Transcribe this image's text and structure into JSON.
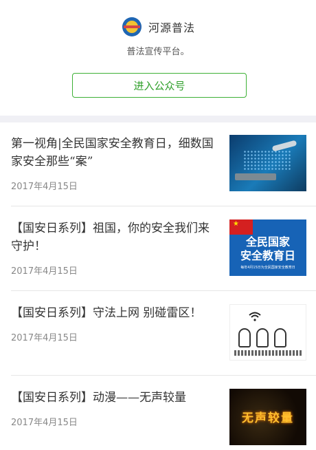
{
  "account": {
    "name": "河源普法",
    "description": "普法宣传平台。",
    "follow_label": "进入公众号"
  },
  "articles": [
    {
      "title": "第一视角|全民国家安全教育日，细数国家安全那些“案”",
      "date": "2017年4月15日"
    },
    {
      "title": "【国安日系列】祖国，你的安全我们来守护！",
      "date": "2017年4月15日",
      "thumb_text": {
        "line1": "全民国家",
        "line2": "安全教育日",
        "line3": "每年4月15日为全民国家安全教育日"
      }
    },
    {
      "title": "【国安日系列】守法上网 别碰雷区！",
      "date": "2017年4月15日"
    },
    {
      "title": "【国安日系列】动漫——无声较量",
      "date": "2017年4月15日",
      "thumb_text": "无声较量"
    }
  ],
  "colors": {
    "accent": "#2e9f29",
    "separator": "#f0f0f5"
  }
}
